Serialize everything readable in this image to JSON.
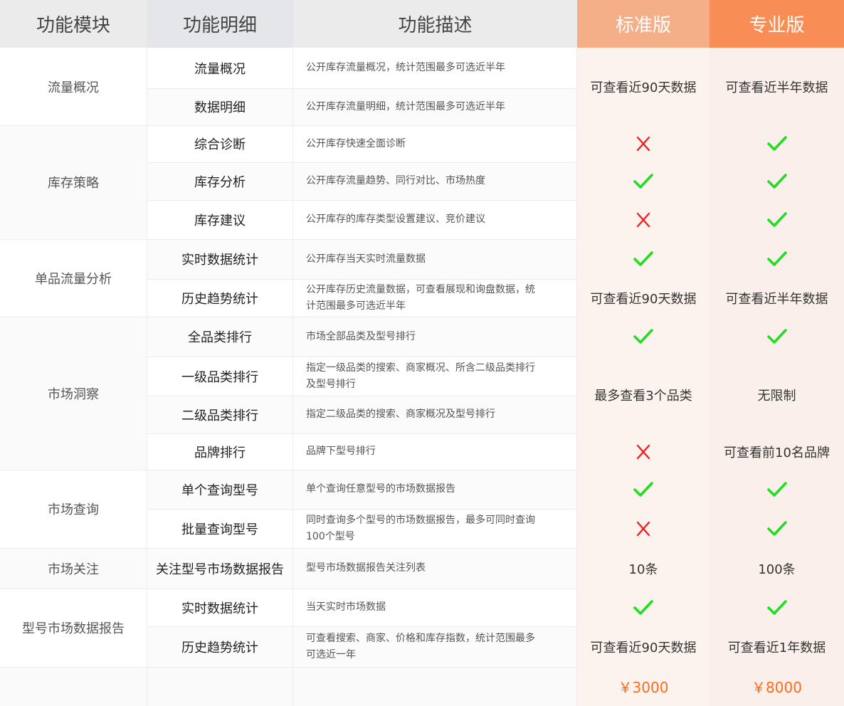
{
  "colors": {
    "header_bg": "#ebebeb",
    "header_detail_bg": "#e4e6e9",
    "standard_header": "#f5af88",
    "pro_header": "#f88e55",
    "standard_col_bg": "#fdf3ee",
    "pro_col_bg": "#faefea",
    "check": "#22dd22",
    "cross": "#ee2222",
    "price": "#ff6a1a"
  },
  "header": {
    "module": "功能模块",
    "detail": "功能明细",
    "description": "功能描述",
    "standard": "标准版",
    "pro": "专业版"
  },
  "modules": [
    {
      "label": "流量概况"
    },
    {
      "label": "库存策略"
    },
    {
      "label": "单品流量分析"
    },
    {
      "label": "市场洞察"
    },
    {
      "label": "市场查询"
    },
    {
      "label": "市场关注"
    },
    {
      "label": "型号市场数据报告"
    }
  ],
  "rows": [
    {
      "detail": "流量概况",
      "description": "公开库存流量概况，统计范围最多可选近半年"
    },
    {
      "detail": "数据明细",
      "description": "公开库存流量明细，统计范围最多可选近半年"
    },
    {
      "detail": "综合诊断",
      "description": "公开库存快速全面诊断"
    },
    {
      "detail": "库存分析",
      "description": "公开库存流量趋势、同行对比、市场热度"
    },
    {
      "detail": "库存建议",
      "description": "公开库存的库存类型设置建议、竞价建议"
    },
    {
      "detail": "实时数据统计",
      "description": "公开库存当天实时流量数据"
    },
    {
      "detail": "历史趋势统计",
      "description": "公开库存历史流量数据，可查看展现和询盘数据，统计范围最多可选近半年"
    },
    {
      "detail": "全品类排行",
      "description": "市场全部品类及型号排行"
    },
    {
      "detail": "一级品类排行",
      "description": "指定一级品类的搜索、商家概况、所含二级品类排行及型号排行"
    },
    {
      "detail": "二级品类排行",
      "description": "指定二级品类的搜索、商家概况及型号排行"
    },
    {
      "detail": "品牌排行",
      "description": "品牌下型号排行"
    },
    {
      "detail": "单个查询型号",
      "description": "单个查询任意型号的市场数据报告"
    },
    {
      "detail": "批量查询型号",
      "description": "同时查询多个型号的市场数据报告，最多可同时查询100个型号"
    },
    {
      "detail": "关注型号市场数据报告",
      "description": "型号市场数据报告关注列表"
    },
    {
      "detail": "实时数据统计",
      "description": "当天实时市场数据"
    },
    {
      "detail": "历史趋势统计",
      "description": "可查看搜索、商家、价格和库存指数，统计范围最多可选近一年"
    }
  ],
  "standard": [
    {
      "kind": "text",
      "text": "可查看近90天数据"
    },
    {
      "kind": "cross",
      "icon": "cross-icon"
    },
    {
      "kind": "check",
      "icon": "check-icon"
    },
    {
      "kind": "cross",
      "icon": "cross-icon"
    },
    {
      "kind": "check",
      "icon": "check-icon"
    },
    {
      "kind": "text",
      "text": "可查看近90天数据"
    },
    {
      "kind": "check",
      "icon": "check-icon"
    },
    {
      "kind": "text",
      "text": "最多查看3个品类"
    },
    {
      "kind": "cross",
      "icon": "cross-icon"
    },
    {
      "kind": "check",
      "icon": "check-icon"
    },
    {
      "kind": "cross",
      "icon": "cross-icon"
    },
    {
      "kind": "text",
      "text": "10条"
    },
    {
      "kind": "check",
      "icon": "check-icon"
    },
    {
      "kind": "text",
      "text": "可查看近90天数据"
    }
  ],
  "pro": [
    {
      "kind": "text",
      "text": "可查看近半年数据"
    },
    {
      "kind": "check",
      "icon": "check-icon"
    },
    {
      "kind": "check",
      "icon": "check-icon"
    },
    {
      "kind": "check",
      "icon": "check-icon"
    },
    {
      "kind": "check",
      "icon": "check-icon"
    },
    {
      "kind": "text",
      "text": "可查看近半年数据"
    },
    {
      "kind": "check",
      "icon": "check-icon"
    },
    {
      "kind": "text",
      "text": "无限制"
    },
    {
      "kind": "text",
      "text": "可查看前10名品牌"
    },
    {
      "kind": "check",
      "icon": "check-icon"
    },
    {
      "kind": "check",
      "icon": "check-icon"
    },
    {
      "kind": "text",
      "text": "100条"
    },
    {
      "kind": "check",
      "icon": "check-icon"
    },
    {
      "kind": "text",
      "text": "可查看近1年数据"
    }
  ],
  "price": {
    "standard": "￥3000",
    "pro": "￥8000"
  }
}
